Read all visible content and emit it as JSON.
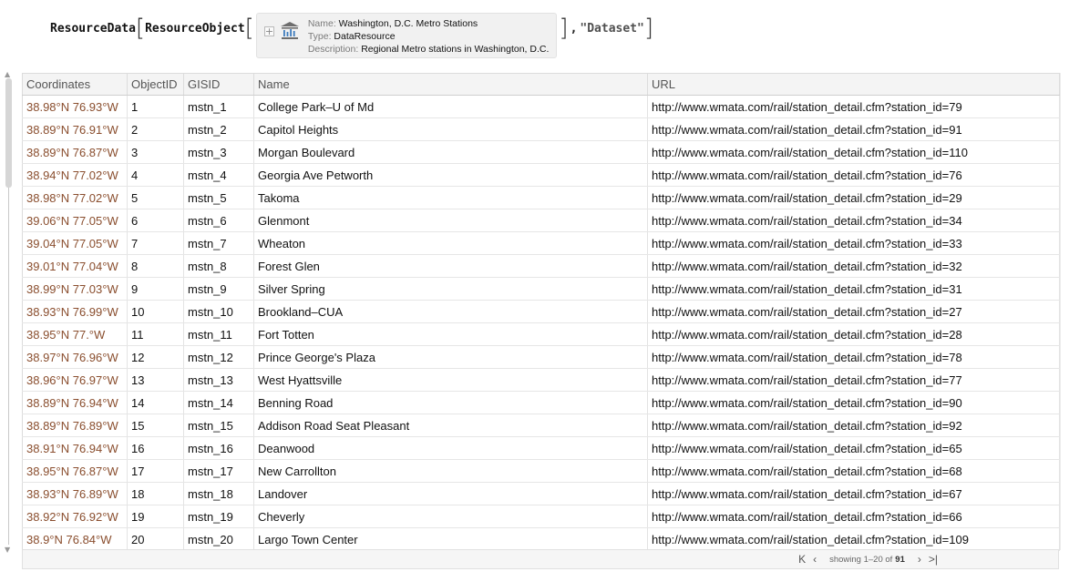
{
  "expression": {
    "function": "ResourceData",
    "inner_function": "ResourceObject",
    "argument": "\"Dataset\"",
    "resource": {
      "name_label": "Name:",
      "name": "Washington, D.C. Metro Stations",
      "type_label": "Type:",
      "type": "DataResource",
      "description_label": "Description:",
      "description": "Regional Metro stations in Washington, D.C."
    }
  },
  "table": {
    "columns": [
      "Coordinates",
      "ObjectID",
      "GISID",
      "Name",
      "URL"
    ],
    "rows": [
      {
        "coord": "38.98°N 76.93°W",
        "id": "1",
        "gisid": "mstn_1",
        "name": "College Park–U of Md",
        "url": "http://www.wmata.com/rail/station_detail.cfm?station_id=79"
      },
      {
        "coord": "38.89°N 76.91°W",
        "id": "2",
        "gisid": "mstn_2",
        "name": "Capitol Heights",
        "url": "http://www.wmata.com/rail/station_detail.cfm?station_id=91"
      },
      {
        "coord": "38.89°N 76.87°W",
        "id": "3",
        "gisid": "mstn_3",
        "name": "Morgan Boulevard",
        "url": "http://www.wmata.com/rail/station_detail.cfm?station_id=110"
      },
      {
        "coord": "38.94°N 77.02°W",
        "id": "4",
        "gisid": "mstn_4",
        "name": "Georgia Ave Petworth",
        "url": "http://www.wmata.com/rail/station_detail.cfm?station_id=76"
      },
      {
        "coord": "38.98°N 77.02°W",
        "id": "5",
        "gisid": "mstn_5",
        "name": "Takoma",
        "url": "http://www.wmata.com/rail/station_detail.cfm?station_id=29"
      },
      {
        "coord": "39.06°N 77.05°W",
        "id": "6",
        "gisid": "mstn_6",
        "name": "Glenmont",
        "url": "http://www.wmata.com/rail/station_detail.cfm?station_id=34"
      },
      {
        "coord": "39.04°N 77.05°W",
        "id": "7",
        "gisid": "mstn_7",
        "name": "Wheaton",
        "url": "http://www.wmata.com/rail/station_detail.cfm?station_id=33"
      },
      {
        "coord": "39.01°N 77.04°W",
        "id": "8",
        "gisid": "mstn_8",
        "name": "Forest Glen",
        "url": "http://www.wmata.com/rail/station_detail.cfm?station_id=32"
      },
      {
        "coord": "38.99°N 77.03°W",
        "id": "9",
        "gisid": "mstn_9",
        "name": "Silver Spring",
        "url": "http://www.wmata.com/rail/station_detail.cfm?station_id=31"
      },
      {
        "coord": "38.93°N 76.99°W",
        "id": "10",
        "gisid": "mstn_10",
        "name": "Brookland–CUA",
        "url": "http://www.wmata.com/rail/station_detail.cfm?station_id=27"
      },
      {
        "coord": "38.95°N 77.°W",
        "id": "11",
        "gisid": "mstn_11",
        "name": "Fort Totten",
        "url": "http://www.wmata.com/rail/station_detail.cfm?station_id=28"
      },
      {
        "coord": "38.97°N 76.96°W",
        "id": "12",
        "gisid": "mstn_12",
        "name": "Prince George's Plaza",
        "url": "http://www.wmata.com/rail/station_detail.cfm?station_id=78"
      },
      {
        "coord": "38.96°N 76.97°W",
        "id": "13",
        "gisid": "mstn_13",
        "name": "West Hyattsville",
        "url": "http://www.wmata.com/rail/station_detail.cfm?station_id=77"
      },
      {
        "coord": "38.89°N 76.94°W",
        "id": "14",
        "gisid": "mstn_14",
        "name": "Benning Road",
        "url": "http://www.wmata.com/rail/station_detail.cfm?station_id=90"
      },
      {
        "coord": "38.89°N 76.89°W",
        "id": "15",
        "gisid": "mstn_15",
        "name": "Addison Road Seat Pleasant",
        "url": "http://www.wmata.com/rail/station_detail.cfm?station_id=92"
      },
      {
        "coord": "38.91°N 76.94°W",
        "id": "16",
        "gisid": "mstn_16",
        "name": "Deanwood",
        "url": "http://www.wmata.com/rail/station_detail.cfm?station_id=65"
      },
      {
        "coord": "38.95°N 76.87°W",
        "id": "17",
        "gisid": "mstn_17",
        "name": "New Carrollton",
        "url": "http://www.wmata.com/rail/station_detail.cfm?station_id=68"
      },
      {
        "coord": "38.93°N 76.89°W",
        "id": "18",
        "gisid": "mstn_18",
        "name": "Landover",
        "url": "http://www.wmata.com/rail/station_detail.cfm?station_id=67"
      },
      {
        "coord": "38.92°N 76.92°W",
        "id": "19",
        "gisid": "mstn_19",
        "name": "Cheverly",
        "url": "http://www.wmata.com/rail/station_detail.cfm?station_id=66"
      },
      {
        "coord": "38.9°N 76.84°W",
        "id": "20",
        "gisid": "mstn_20",
        "name": "Largo Town Center",
        "url": "http://www.wmata.com/rail/station_detail.cfm?station_id=109"
      }
    ]
  },
  "pager": {
    "showing_text": "showing 1–20 of",
    "total": "91",
    "first_icon": "skip-first-icon",
    "prev_icon": "previous-icon",
    "next_icon": "next-icon",
    "last_icon": "skip-last-icon"
  }
}
